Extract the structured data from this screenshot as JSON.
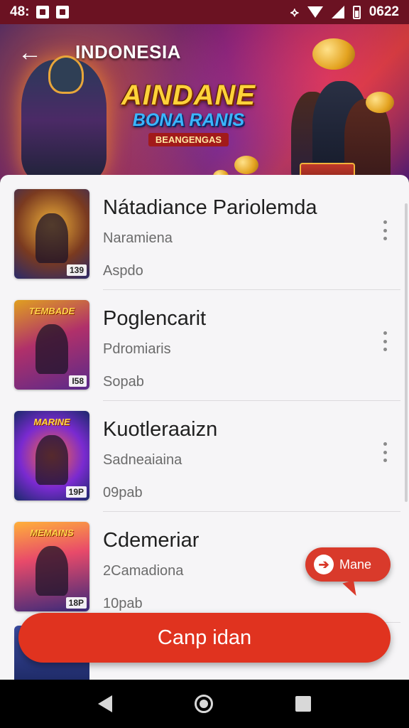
{
  "status_bar": {
    "time": "48:",
    "right_text": "0622",
    "icons": [
      "notification-icon",
      "vibrate-icon",
      "wifi-icon",
      "signal-icon",
      "battery-icon"
    ]
  },
  "hero": {
    "title": "INDONESIA",
    "logo_main": "AINDANE",
    "logo_sub": "BONA RANIS",
    "logo_tag": "BEANGENGAS"
  },
  "list": {
    "items": [
      {
        "title": "Nátadiance Pariolemda",
        "subtitle": "Naramiena",
        "meta": "Aspdo",
        "thumb_title": "",
        "thumb_badge": "139",
        "thumb_colors": [
          "#f0b23a",
          "#2a2a6a"
        ]
      },
      {
        "title": "Poglencarit",
        "subtitle": "Pdromiaris",
        "meta": "Sopab",
        "thumb_title": "TEMBADE",
        "thumb_badge": "I58",
        "thumb_colors": [
          "#e0a020",
          "#5a2a8a"
        ]
      },
      {
        "title": "Kuotleraaizn",
        "subtitle": "Sadneaiaina",
        "meta": "09pab",
        "thumb_title": "MARINE",
        "thumb_badge": "19P",
        "thumb_colors": [
          "#7a2ad0",
          "#1a2a6a"
        ]
      },
      {
        "title": "Cdemeriar",
        "subtitle": "2Camadiona",
        "meta": "10pab",
        "thumb_title": "MEMAINS",
        "thumb_badge": "18P",
        "thumb_colors": [
          "#e84a6a",
          "#3a2a7a"
        ]
      }
    ]
  },
  "chip": {
    "label": "Mane",
    "icon": "arrow-right-icon"
  },
  "cta": {
    "label": "Canp idan"
  },
  "colors": {
    "accent": "#e0331f",
    "status_bar": "#6b1222",
    "sheet_bg": "#f6f5f7"
  }
}
